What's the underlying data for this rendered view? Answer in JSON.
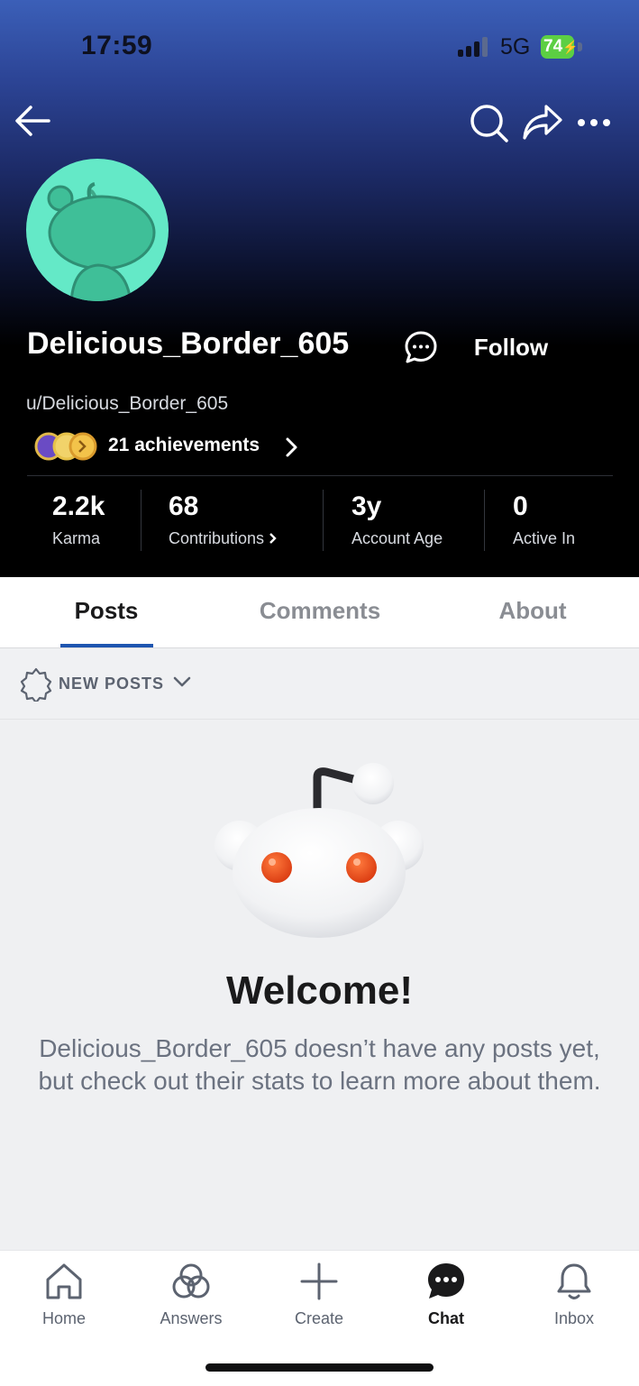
{
  "status_bar": {
    "time": "17:59",
    "network": "5G",
    "battery": "74"
  },
  "header": {
    "username": "Delicious_Border_605",
    "handle": "u/Delicious_Border_605",
    "follow_label": "Follow",
    "achievements_label": "21 achievements",
    "icons": [
      "back-arrow-icon",
      "search-icon",
      "share-icon",
      "more-icon",
      "chat-bubble-icon"
    ]
  },
  "stats": [
    {
      "value": "2.2k",
      "label": "Karma"
    },
    {
      "value": "68",
      "label": "Contributions"
    },
    {
      "value": "3y",
      "label": "Account Age"
    },
    {
      "value": "0",
      "label": "Active In"
    }
  ],
  "tabs": [
    {
      "label": "Posts",
      "active": true
    },
    {
      "label": "Comments",
      "active": false
    },
    {
      "label": "About",
      "active": false
    }
  ],
  "filter": {
    "label": "NEW POSTS"
  },
  "empty_state": {
    "title": "Welcome!",
    "body": "Delicious_Border_605 doesn’t have any posts yet, but check out their stats to learn more about them."
  },
  "bottom_nav": [
    {
      "label": "Home",
      "icon": "home-icon",
      "active": false
    },
    {
      "label": "Answers",
      "icon": "answers-icon",
      "active": false
    },
    {
      "label": "Create",
      "icon": "plus-icon",
      "active": false
    },
    {
      "label": "Chat",
      "icon": "chat-icon",
      "active": true
    },
    {
      "label": "Inbox",
      "icon": "bell-icon",
      "active": false
    }
  ],
  "colors": {
    "accent": "#1e55b0",
    "avatar_bg": "#64e9c7",
    "battery": "#5ccf43"
  }
}
